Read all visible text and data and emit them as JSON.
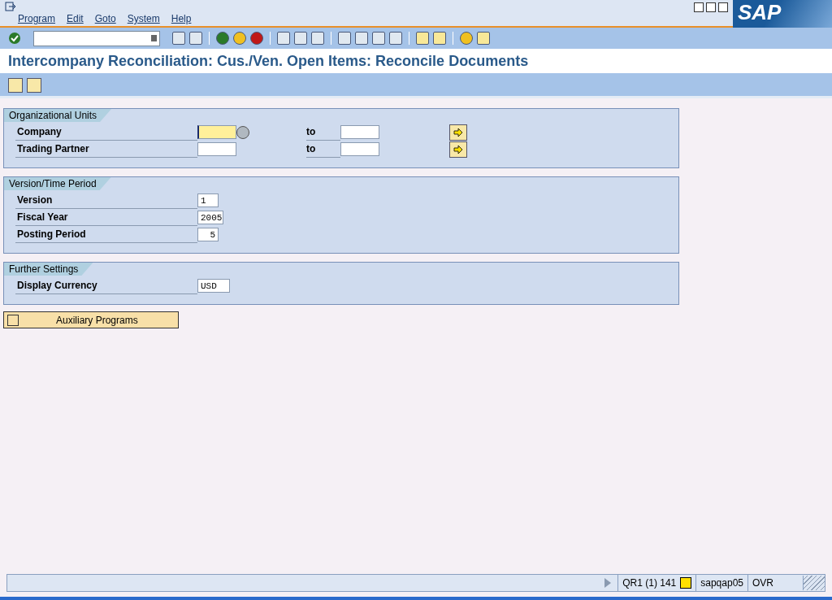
{
  "menu": [
    "Program",
    "Edit",
    "Goto",
    "System",
    "Help"
  ],
  "logo": "SAP",
  "title": "Intercompany Reconciliation: Cus./Ven. Open Items: Reconcile Documents",
  "sections": [
    {
      "title": "Organizational Units",
      "rows": [
        {
          "label": "Company",
          "field": {
            "focused": true,
            "matchcode": true
          },
          "to": {
            "label": "to"
          },
          "multiple": true
        },
        {
          "label": "Trading Partner",
          "field": {
            "focused": false,
            "matchcode": false
          },
          "to": {
            "label": "to"
          },
          "multiple": true
        }
      ]
    },
    {
      "title": "Version/Time Period",
      "rows": [
        {
          "label": "Version",
          "field": {
            "value": "1",
            "focused": false,
            "matchcode": false
          },
          "multiple": false
        },
        {
          "label": "Fiscal Year",
          "field": {
            "value": "2005",
            "focused": false,
            "matchcode": false
          },
          "multiple": false
        },
        {
          "label": "Posting Period",
          "field": {
            "value": "5",
            "focused": false,
            "matchcode": false
          },
          "multiple": false
        }
      ]
    },
    {
      "title": "Further Settings",
      "rows": [
        {
          "label": "Display Currency",
          "field": {
            "value": "USD",
            "focused": false,
            "matchcode": false
          },
          "multiple": false
        }
      ]
    }
  ],
  "aux_button": "Auxiliary Programs",
  "status_bar": {
    "system": "QR1 (1) 141",
    "server": "sapqap05",
    "mode": "OVR"
  }
}
